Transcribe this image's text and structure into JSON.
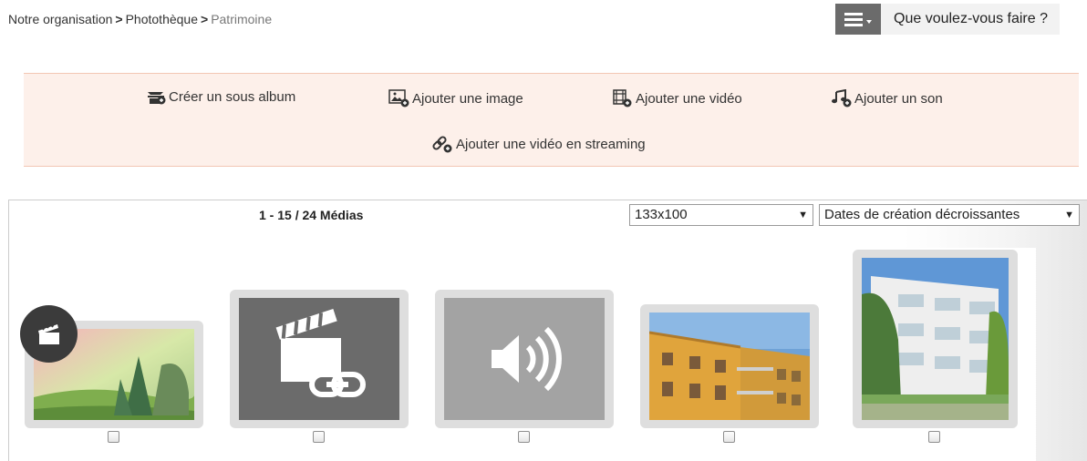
{
  "breadcrumb": {
    "items": [
      "Notre organisation",
      "Photothèque",
      "Patrimoine"
    ],
    "separator": ">"
  },
  "action_menu": {
    "label": "Que voulez-vous faire ?",
    "icon": "hamburger-menu-icon"
  },
  "actions": [
    {
      "label": "Créer un sous album",
      "icon": "add-album-icon"
    },
    {
      "label": "Ajouter une image",
      "icon": "add-image-icon"
    },
    {
      "label": "Ajouter une vidéo",
      "icon": "add-video-icon"
    },
    {
      "label": "Ajouter un son",
      "icon": "add-sound-icon"
    },
    {
      "label": "Ajouter une vidéo en streaming",
      "icon": "add-streaming-icon"
    }
  ],
  "media": {
    "count_label": "1 - 15 / 24 Médias",
    "size_select": {
      "value": "133x100"
    },
    "sort_select": {
      "value": "Dates de création décroissantes"
    },
    "thumbnails": [
      {
        "type": "video",
        "content": "landscape-painting-image",
        "badge": "clapperboard-icon"
      },
      {
        "type": "streaming-video",
        "content": "clapperboard-link-icon"
      },
      {
        "type": "sound",
        "content": "speaker-icon"
      },
      {
        "type": "image",
        "content": "yellow-building-photo"
      },
      {
        "type": "image",
        "content": "white-building-photo"
      }
    ]
  },
  "colors": {
    "action_bar_bg": "#fdf0ea",
    "action_bar_border": "#f2c6b4",
    "menu_button_bg": "#6b6b6b"
  }
}
